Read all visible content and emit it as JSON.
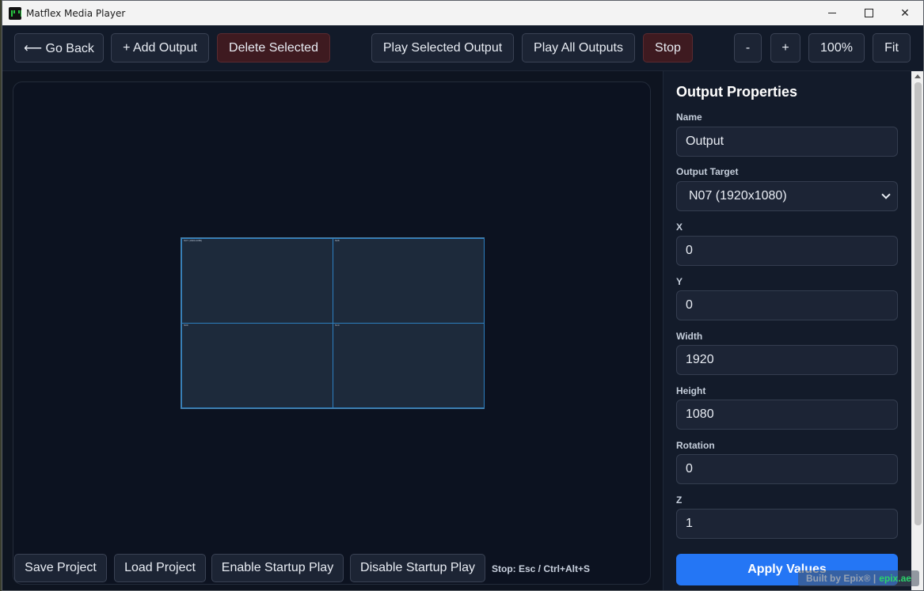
{
  "window": {
    "title": "Matflex Media Player",
    "controls": {
      "minimize": "—",
      "maximize": "☐",
      "close": "✕"
    }
  },
  "toolbar": {
    "go_back": "⟵ Go Back",
    "add_output": "+ Add Output",
    "delete_selected": "Delete Selected",
    "play_selected": "Play Selected Output",
    "play_all": "Play All Outputs",
    "stop": "Stop",
    "zoom_out": "-",
    "zoom_in": "+",
    "zoom_level": "100%",
    "fit": "Fit"
  },
  "canvas": {
    "cells": [
      {
        "tag": "N07 (1920x1080)"
      },
      {
        "tag": "N08"
      },
      {
        "tag": "N09"
      },
      {
        "tag": "N10"
      }
    ]
  },
  "bottom_bar": {
    "save_project": "Save Project",
    "load_project": "Load Project",
    "enable_startup": "Enable Startup Play",
    "disable_startup": "Disable Startup Play",
    "stop_hint": "Stop: Esc / Ctrl+Alt+S"
  },
  "properties": {
    "title": "Output Properties",
    "name_label": "Name",
    "name_value": "Output",
    "target_label": "Output Target",
    "target_value": "N07 (1920x1080)",
    "x_label": "X",
    "x_value": "0",
    "y_label": "Y",
    "y_value": "0",
    "width_label": "Width",
    "width_value": "1920",
    "height_label": "Height",
    "height_value": "1080",
    "rotation_label": "Rotation",
    "rotation_value": "0",
    "z_label": "Z",
    "z_value": "1",
    "apply_label": "Apply Values"
  },
  "footer": {
    "built_by": "Built by Epix® |",
    "link": "epix.ae"
  },
  "colors": {
    "accent": "#2476f5",
    "danger": "#3e1a20",
    "background": "#0e1420",
    "link": "#2bd26b"
  }
}
